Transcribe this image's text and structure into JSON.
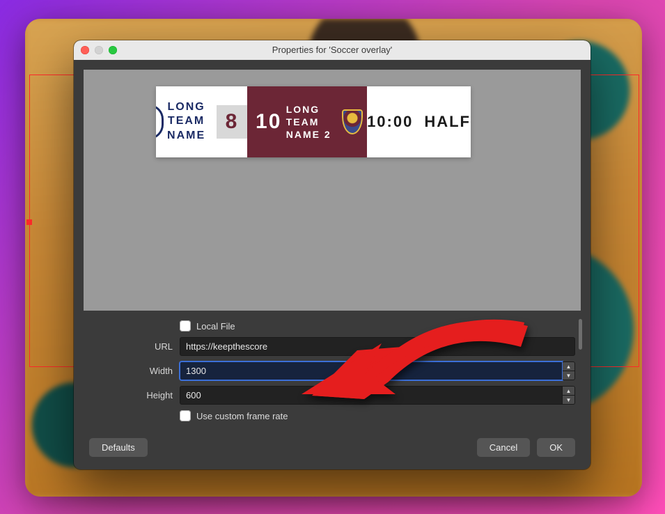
{
  "window": {
    "title": "Properties for 'Soccer overlay'"
  },
  "scoreboard": {
    "team1": "LONG TEAM NAME",
    "score1": "8",
    "score2": "10",
    "team2": "LONG TEAM NAME 2",
    "clock": "10:00",
    "period": "HALF"
  },
  "form": {
    "local_file_label": "Local File",
    "url_label": "URL",
    "url_value": "https://keepthescore",
    "width_label": "Width",
    "width_value": "1300",
    "height_label": "Height",
    "height_value": "600",
    "custom_frame_label": "Use custom frame rate"
  },
  "buttons": {
    "defaults": "Defaults",
    "cancel": "Cancel",
    "ok": "OK"
  }
}
